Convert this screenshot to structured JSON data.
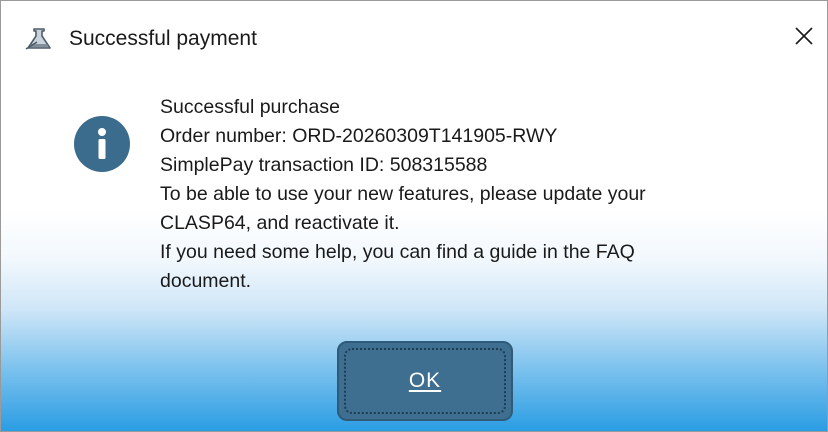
{
  "window": {
    "title": "Successful payment",
    "app_icon": "flask-icon",
    "close_icon": "close-icon"
  },
  "message": {
    "icon": "info-icon",
    "lines": [
      "Successful purchase",
      "Order number: ORD-20260309T141905-RWY",
      "SimplePay transaction ID: 508315588",
      "To be able to use your new features, please update your",
      "CLASP64, and reactivate it.",
      "If you need some help, you can find a guide in the FAQ",
      "document."
    ]
  },
  "buttons": {
    "ok_label": "OK"
  },
  "colors": {
    "info_circle": "#3b6c8e",
    "button_fill": "#3f6f90",
    "gradient_bottom": "#2a9de3"
  }
}
